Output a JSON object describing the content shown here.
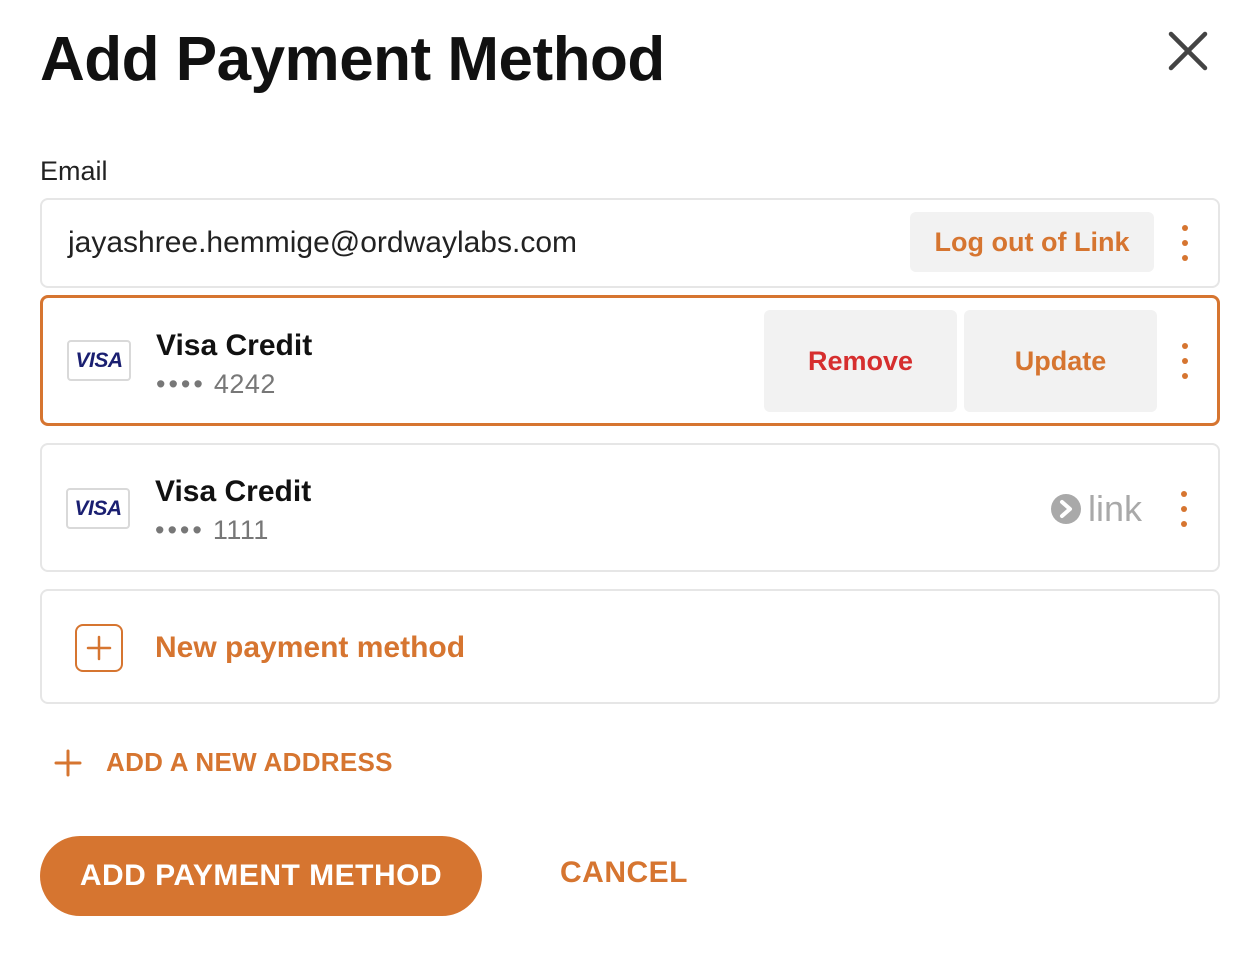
{
  "modal": {
    "title": "Add Payment Method",
    "close_icon": "close-icon"
  },
  "email": {
    "label": "Email",
    "value": "jayashree.hemmige@ordwaylabs.com",
    "logout_label": "Log out of Link",
    "menu_icon": "kebab-icon"
  },
  "payment_methods": [
    {
      "brand": "VISA",
      "name": "Visa Credit",
      "dots": "••••",
      "last4": "4242",
      "selected": true,
      "remove_label": "Remove",
      "update_label": "Update"
    },
    {
      "brand": "VISA",
      "name": "Visa Credit",
      "dots": "••••",
      "last4": "1111",
      "selected": false,
      "badge": "link"
    }
  ],
  "new_payment_method": {
    "label": "New payment method",
    "icon": "plus-square-icon"
  },
  "address": {
    "add_label": "ADD A NEW ADDRESS",
    "icon": "plus-icon"
  },
  "actions": {
    "primary_label": "ADD PAYMENT METHOD",
    "cancel_label": "CANCEL"
  },
  "colors": {
    "accent": "#d67530",
    "danger": "#d62e2e",
    "visa_blue": "#1a1f71",
    "muted": "#a9a9a9"
  }
}
